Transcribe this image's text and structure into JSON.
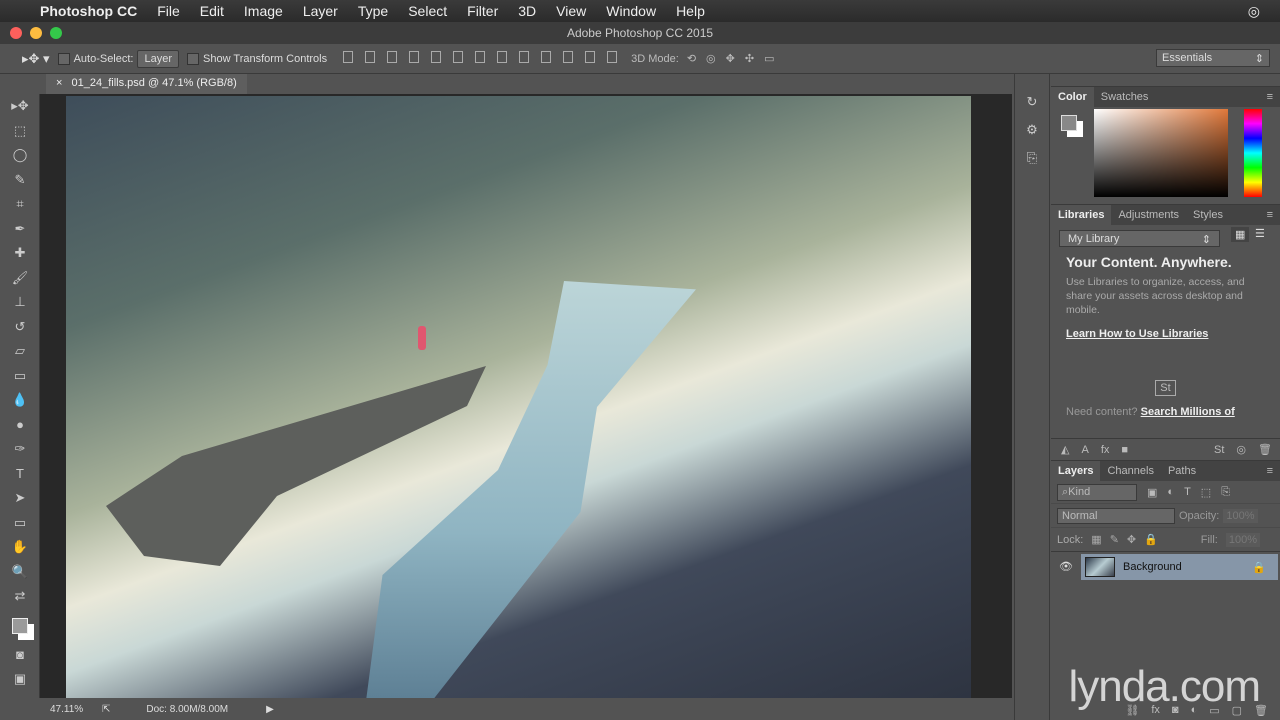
{
  "menubar": {
    "app": "Photoshop CC",
    "items": [
      "File",
      "Edit",
      "Image",
      "Layer",
      "Type",
      "Select",
      "Filter",
      "3D",
      "View",
      "Window",
      "Help"
    ]
  },
  "window": {
    "title": "Adobe Photoshop CC 2015"
  },
  "options": {
    "auto_select_label": "Auto-Select:",
    "auto_select_value": "Layer",
    "show_transform": "Show Transform Controls",
    "mode3d": "3D Mode:",
    "workspace": "Essentials"
  },
  "document": {
    "tab": "01_24_fills.psd @ 47.1% (RGB/8)",
    "close": "×"
  },
  "status": {
    "zoom": "47.11%",
    "doc": "Doc: 8.00M/8.00M"
  },
  "color_panel": {
    "tabs": [
      "Color",
      "Swatches"
    ]
  },
  "libraries": {
    "tabs": [
      "Libraries",
      "Adjustments",
      "Styles"
    ],
    "library": "My Library",
    "heading": "Your Content. Anywhere.",
    "body": "Use Libraries to organize, access, and share your assets across desktop and mobile.",
    "learn_link": "Learn How to Use Libraries",
    "stock": "St",
    "need": "Need content?",
    "search_link": "Search Millions of"
  },
  "layers": {
    "tabs": [
      "Layers",
      "Channels",
      "Paths"
    ],
    "filter": "Kind",
    "blend": "Normal",
    "opacity_label": "Opacity:",
    "opacity": "100%",
    "lock_label": "Lock:",
    "fill_label": "Fill:",
    "fill": "100%",
    "items": [
      {
        "name": "Background"
      }
    ]
  },
  "watermark": "lynda.com"
}
